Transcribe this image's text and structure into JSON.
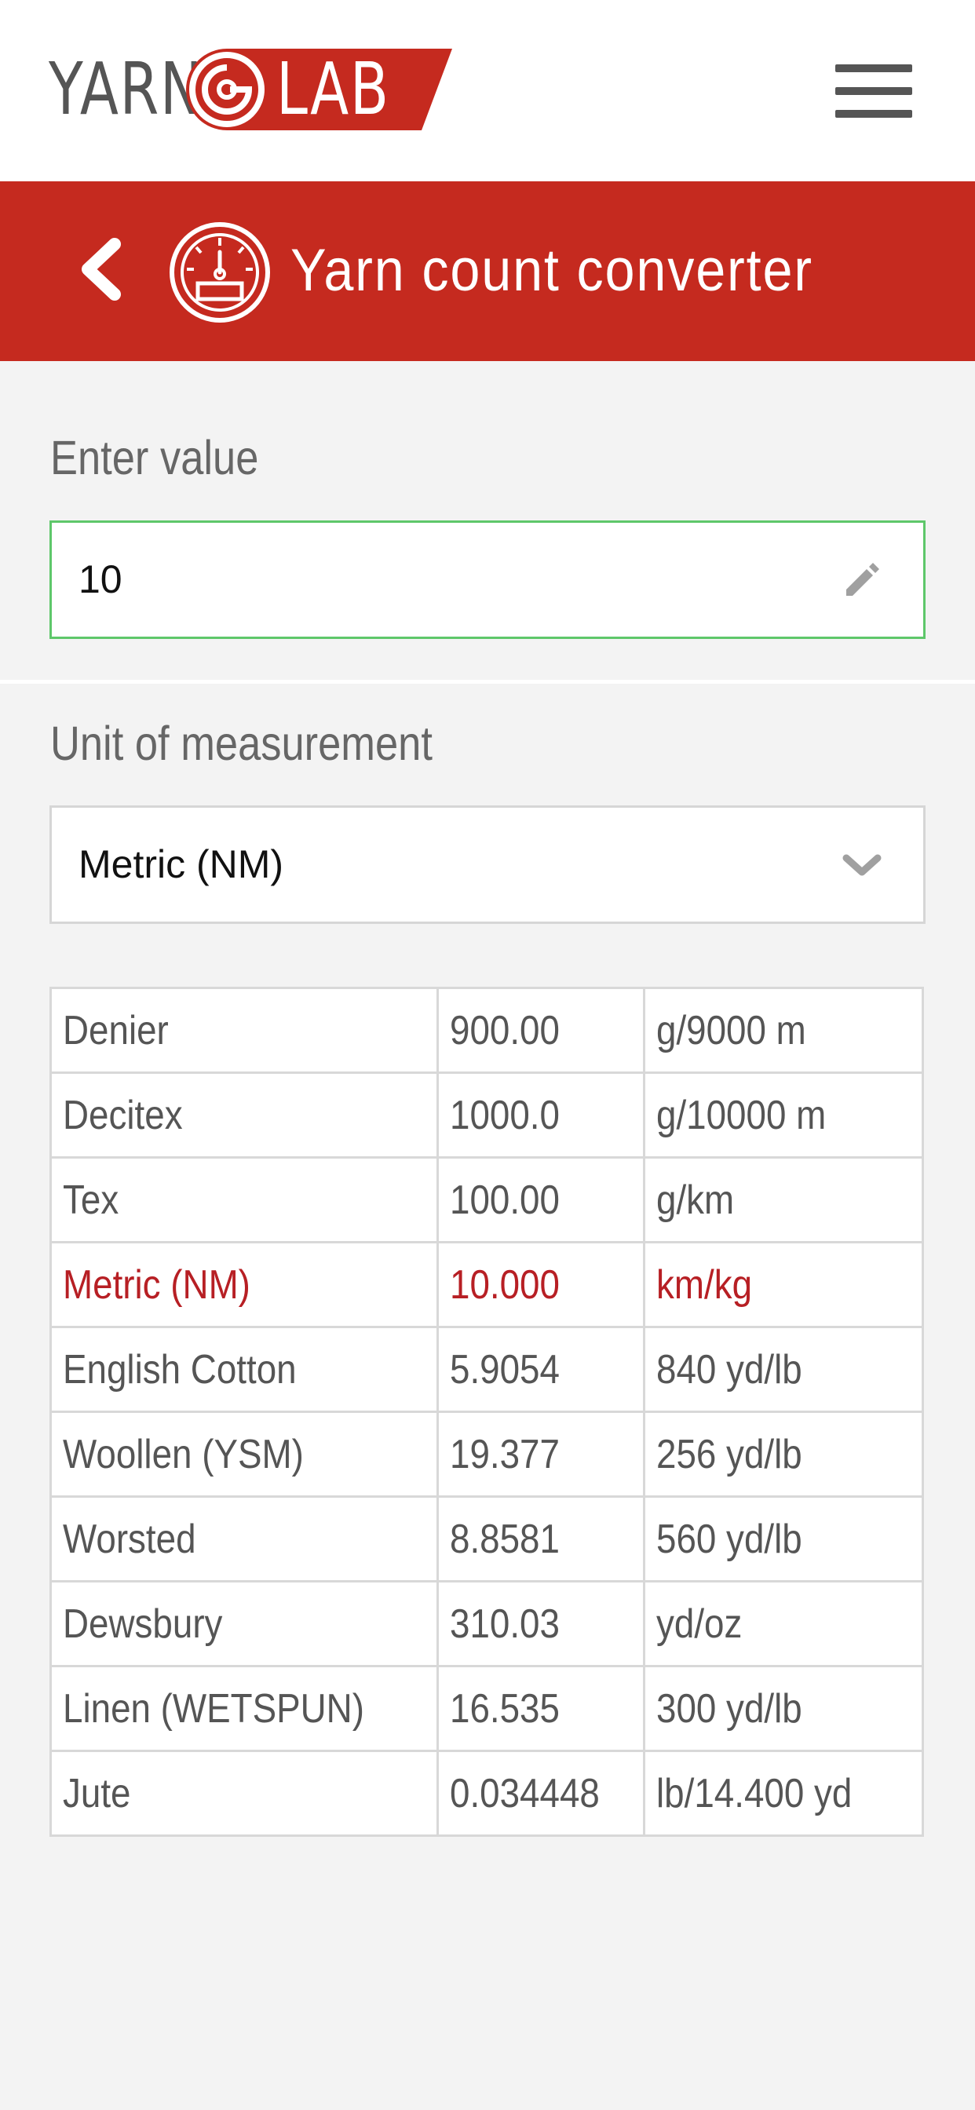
{
  "header": {
    "logo_left": "YARN",
    "logo_right": "LAB",
    "menu_icon": "hamburger-menu-icon"
  },
  "titlebar": {
    "back_icon": "chevron-left-icon",
    "tool_icon": "gauge-icon",
    "title": "Yarn count converter"
  },
  "input": {
    "label": "Enter value",
    "value": "10",
    "icon": "pencil-icon"
  },
  "unit": {
    "label": "Unit of measurement",
    "selected": "Metric (NM)",
    "icon": "chevron-down-icon"
  },
  "colors": {
    "brand_red": "#c52a1f",
    "active_row": "#b71f24",
    "input_border_focus": "#5ec76a"
  },
  "results": [
    {
      "name": "Denier",
      "value": "900.00",
      "unit": "g/9000 m",
      "active": false
    },
    {
      "name": "Decitex",
      "value": "1000.0",
      "unit": "g/10000 m",
      "active": false
    },
    {
      "name": "Tex",
      "value": "100.00",
      "unit": "g/km",
      "active": false
    },
    {
      "name": "Metric (NM)",
      "value": "10.000",
      "unit": "km/kg",
      "active": true
    },
    {
      "name": "English Cotton",
      "value": "5.9054",
      "unit": "840 yd/lb",
      "active": false
    },
    {
      "name": "Woollen (YSM)",
      "value": "19.377",
      "unit": "256 yd/lb",
      "active": false
    },
    {
      "name": "Worsted",
      "value": "8.8581",
      "unit": "560 yd/lb",
      "active": false
    },
    {
      "name": "Dewsbury",
      "value": "310.03",
      "unit": "yd/oz",
      "active": false
    },
    {
      "name": "Linen (WETSPUN)",
      "value": "16.535",
      "unit": "300 yd/lb",
      "active": false
    },
    {
      "name": "Jute",
      "value": "0.034448",
      "unit": "lb/14.400 yd",
      "active": false
    }
  ]
}
